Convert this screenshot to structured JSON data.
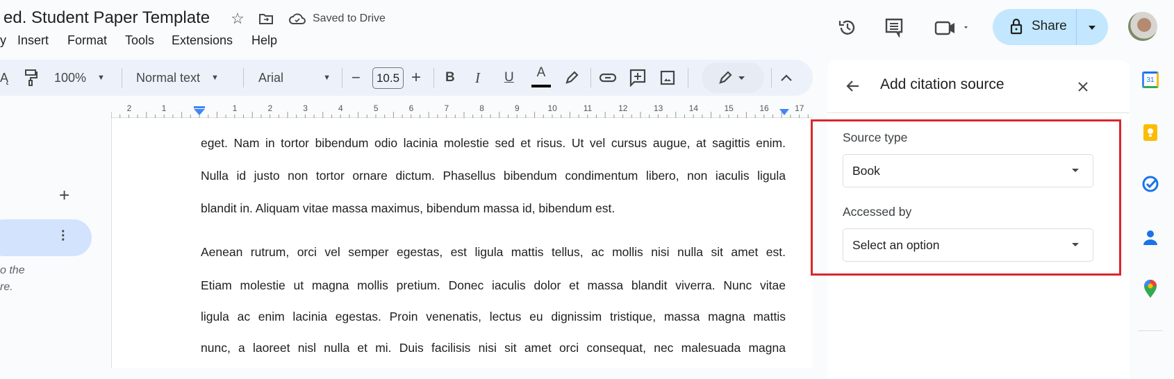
{
  "header": {
    "title": "ed. Student Paper Template",
    "saved_status": "Saved to Drive",
    "share_label": "Share"
  },
  "menu": {
    "items": [
      "y",
      "Insert",
      "Format",
      "Tools",
      "Extensions",
      "Help"
    ]
  },
  "toolbar": {
    "zoom": "100%",
    "style": "Normal text",
    "font": "Arial",
    "font_size": "10.5",
    "bold": "B",
    "italic": "I",
    "underline": "U",
    "text_color": "A",
    "text_color_value": "#000000"
  },
  "ruler": {
    "ticks": [
      "2",
      "1",
      "1",
      "2",
      "3",
      "4",
      "5",
      "6",
      "7",
      "8",
      "9",
      "10",
      "11",
      "12",
      "13",
      "14",
      "15",
      "16",
      "17"
    ]
  },
  "document": {
    "lines": [
      "eget. Nam in tortor bibendum odio lacinia molestie sed et risus. Ut vel cursus augue, at sagittis enim.",
      "Nulla id justo non tortor ornare dictum. Phasellus bibendum condimentum libero, non iaculis ligula",
      "blandit in. Aliquam vitae massa maximus, bibendum massa id, bibendum est.",
      "Aenean rutrum, orci vel semper egestas, est ligula mattis tellus, ac mollis nisi nulla sit amet est.",
      "Etiam molestie ut magna mollis pretium. Donec iaculis dolor et massa blandit viverra. Nunc vitae",
      "ligula ac enim lacinia egestas. Proin venenatis, lectus eu dignissim tristique, massa magna mattis",
      "nunc, a laoreet nisl nulla et mi. Duis facilisis nisi sit amet orci consequat, nec malesuada magna"
    ]
  },
  "outline": {
    "hint_line1": "o the",
    "hint_line2": "re."
  },
  "citation_panel": {
    "title": "Add citation source",
    "source_type_label": "Source type",
    "source_type_value": "Book",
    "accessed_by_label": "Accessed by",
    "accessed_by_placeholder": "Select an option",
    "highlight_color": "#d9262c"
  },
  "side_apps": {
    "calendar_day": "31"
  }
}
